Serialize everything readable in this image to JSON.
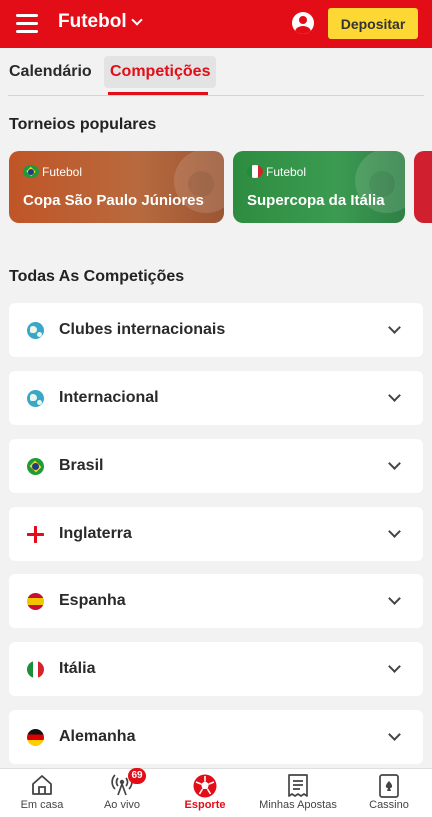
{
  "header": {
    "sport_label": "Futebol",
    "deposit_label": "Depositar"
  },
  "tabs": [
    {
      "label": "Calendário",
      "active": false
    },
    {
      "label": "Competições",
      "active": true
    }
  ],
  "popular": {
    "title": "Torneios populares",
    "cards": [
      {
        "sport": "Futebol",
        "name": "Copa São Paulo Júniores",
        "flag": "brazil-flag-icon"
      },
      {
        "sport": "Futebol",
        "name": "Supercopa da Itália",
        "flag": "italy-flag-icon"
      }
    ]
  },
  "all": {
    "title": "Todas As Competições",
    "items": [
      {
        "label": "Clubes internacionais",
        "icon": "globe-icon"
      },
      {
        "label": "Internacional",
        "icon": "globe-icon"
      },
      {
        "label": "Brasil",
        "icon": "brazil-flag-icon"
      },
      {
        "label": "Inglaterra",
        "icon": "england-flag-icon"
      },
      {
        "label": "Espanha",
        "icon": "spain-flag-icon"
      },
      {
        "label": "Itália",
        "icon": "italy-flag-icon"
      },
      {
        "label": "Alemanha",
        "icon": "germany-flag-icon"
      }
    ]
  },
  "bottom_nav": {
    "items": [
      {
        "label": "Em casa",
        "icon": "home-icon"
      },
      {
        "label": "Ao vivo",
        "icon": "live-broadcast-icon",
        "badge": "69"
      },
      {
        "label": "Esporte",
        "icon": "soccer-ball-icon",
        "active": true
      },
      {
        "label": "Minhas Apostas",
        "icon": "bet-slip-icon"
      },
      {
        "label": "Cassino",
        "icon": "playing-card-icon"
      }
    ]
  },
  "colors": {
    "brand_red": "#e30d17",
    "deposit_yellow": "#fdd835",
    "background": "#f2f2f2"
  }
}
